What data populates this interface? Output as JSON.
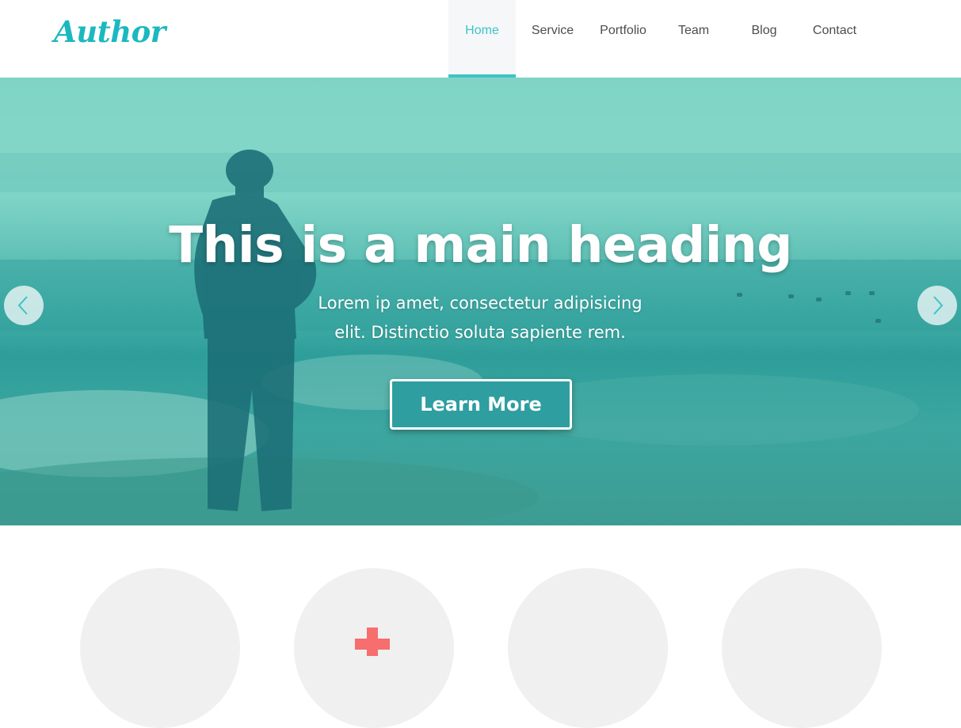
{
  "header": {
    "logo": "Author",
    "nav": [
      {
        "label": "Home",
        "active": true
      },
      {
        "label": "Service",
        "active": false
      },
      {
        "label": "Portfolio",
        "active": false
      },
      {
        "label": "Team",
        "active": false
      },
      {
        "label": "Blog",
        "active": false
      },
      {
        "label": "Contact",
        "active": false
      }
    ]
  },
  "hero": {
    "title": "This is a main heading",
    "subtitle_line1": "Lorem ip amet, consectetur adipisicing",
    "subtitle_line2": "elit. Distinctio soluta sapiente rem.",
    "button_label": "Learn More",
    "prev_icon": "chevron-left-icon",
    "next_icon": "chevron-right-icon"
  },
  "features": {
    "icons": [
      "",
      "plus-icon",
      "",
      ""
    ]
  },
  "colors": {
    "accent": "#3ec3c6",
    "logo": "#1bb8c0",
    "nav_text": "#4c4c4c",
    "hero_overlay": "#3aa9a3",
    "plus_icon": "#f76e6e",
    "circle_bg": "#f0f0f1"
  }
}
